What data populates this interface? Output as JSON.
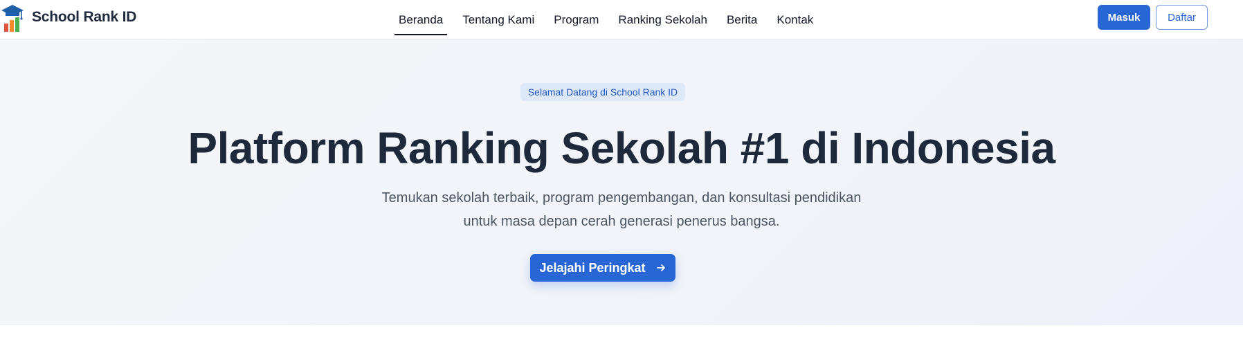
{
  "brand": {
    "name": "School Rank ID",
    "logo_icon": "graduation-cap-bar-chart-icon"
  },
  "nav": {
    "items": [
      {
        "label": "Beranda",
        "active": true
      },
      {
        "label": "Tentang Kami",
        "active": false
      },
      {
        "label": "Program",
        "active": false
      },
      {
        "label": "Ranking Sekolah",
        "active": false
      },
      {
        "label": "Berita",
        "active": false
      },
      {
        "label": "Kontak",
        "active": false
      }
    ]
  },
  "auth": {
    "login_label": "Masuk",
    "register_label": "Daftar"
  },
  "hero": {
    "badge": "Selamat Datang di School Rank ID",
    "title": "Platform Ranking Sekolah #1 di Indonesia",
    "subtitle_line1": "Temukan sekolah terbaik, program pengembangan, dan konsultasi pendidikan",
    "subtitle_line2": "untuk masa depan cerah generasi penerus bangsa.",
    "cta_label": "Jelajahi Peringkat",
    "cta_icon": "arrow-right-icon"
  },
  "colors": {
    "primary": "#2866d6",
    "heading": "#1e293b",
    "badge_bg": "#dde8f8",
    "logo_blue": "#1f5fa8",
    "logo_orange": "#f28c28",
    "logo_red": "#e5533d",
    "logo_green": "#4caf50"
  }
}
